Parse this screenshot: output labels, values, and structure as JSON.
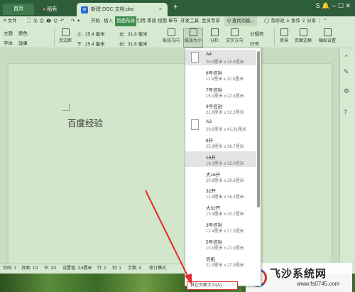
{
  "titlebar": {
    "home_tab": "首页",
    "daoke_tab": "稻壳",
    "doc_tab": "新建 DOC 文档.doc",
    "doc_icon": "W",
    "close_glyph": "×",
    "new_tab_glyph": "+",
    "right_icons": "S 🔔 ─ ☐ ✕"
  },
  "menubar": {
    "file": "≡ 文件",
    "quick_icons": "🗋 🖫 ⎙ 🖨 Q ↶ · ↷ ▾",
    "items": [
      "开始",
      "插入",
      "页面布局",
      "引用",
      "审阅",
      "视图",
      "章节",
      "开发工具",
      "会员专享"
    ],
    "active": "页面布局",
    "search": "Q 查找功能...",
    "right": "◯ 有修改  ♙ 协作  ⇪ 分享  ⋮  ⌃"
  },
  "ribbon": {
    "theme": "主题",
    "font": "字体",
    "effect": "效果",
    "colors": "颜色",
    "margin_label": "页边距",
    "top_label": "上:",
    "top_value": "25.4 毫米",
    "bottom_label": "下:",
    "bottom_value": "25.4 毫米",
    "left_label": "左:",
    "left_value": "31.8 毫米",
    "right_label": "右:",
    "right_value": "31.8 毫米",
    "orientation": "纸张方向",
    "size": "纸张大小",
    "columns": "分栏",
    "text_dir": "文字方向",
    "lines": "行号",
    "break": "分隔符",
    "background": "背景",
    "border": "页面边框",
    "manuscript": "稿纸设置"
  },
  "document": {
    "text": "百度经验"
  },
  "rightbar": {
    "icons": [
      "⌃",
      "✎",
      "⚙",
      "?"
    ]
  },
  "statusbar": {
    "page_no": "页码: 1",
    "pages": "页面: 1/1",
    "section": "节: 1/1",
    "position": "设置值: 3.6厘米",
    "row": "行: 2",
    "col": "列: 1",
    "words": "字数: 4",
    "mode": "修订模式"
  },
  "dropdown": {
    "items": [
      {
        "name": "A4",
        "size": "20.9厘米 x 29.6厘米",
        "selected": true,
        "icon": true
      },
      {
        "name": "6号信封",
        "size": "11.9厘米 x 22.9厘米"
      },
      {
        "name": "7号信封",
        "size": "16.1厘米 x 22.8厘米"
      },
      {
        "name": "9号信封",
        "size": "22.8厘米 x 32.3厘米"
      },
      {
        "name": "A3",
        "size": "29.6厘米 x 41.91厘米",
        "icon": true
      },
      {
        "name": "8开",
        "size": "25.9厘米 x 36.7厘米"
      },
      {
        "name": "16开",
        "size": "18.3厘米 x 25.9厘米",
        "selected": true
      },
      {
        "name": "大16开",
        "size": "20.9厘米 x 29.6厘米"
      },
      {
        "name": "32开",
        "size": "12.9厘米 x 18.3厘米"
      },
      {
        "name": "大32开",
        "size": "13.9厘米 x 20.2厘米"
      },
      {
        "name": "3号信封",
        "size": "12.4厘米 x 17.5厘米"
      },
      {
        "name": "5号信封",
        "size": "10.9厘米 x 21.9厘米"
      },
      {
        "name": "信纸",
        "size": "21.5厘米 x 27.9厘米"
      }
    ],
    "other": "其它页面大小(A)..."
  },
  "watermark": {
    "title": "飞沙系统网",
    "url": "www.fs0745.com"
  },
  "colors": {
    "accent": "#3f8f4d",
    "arrow": "#e02b2b",
    "bg": "#cfe3c9"
  }
}
